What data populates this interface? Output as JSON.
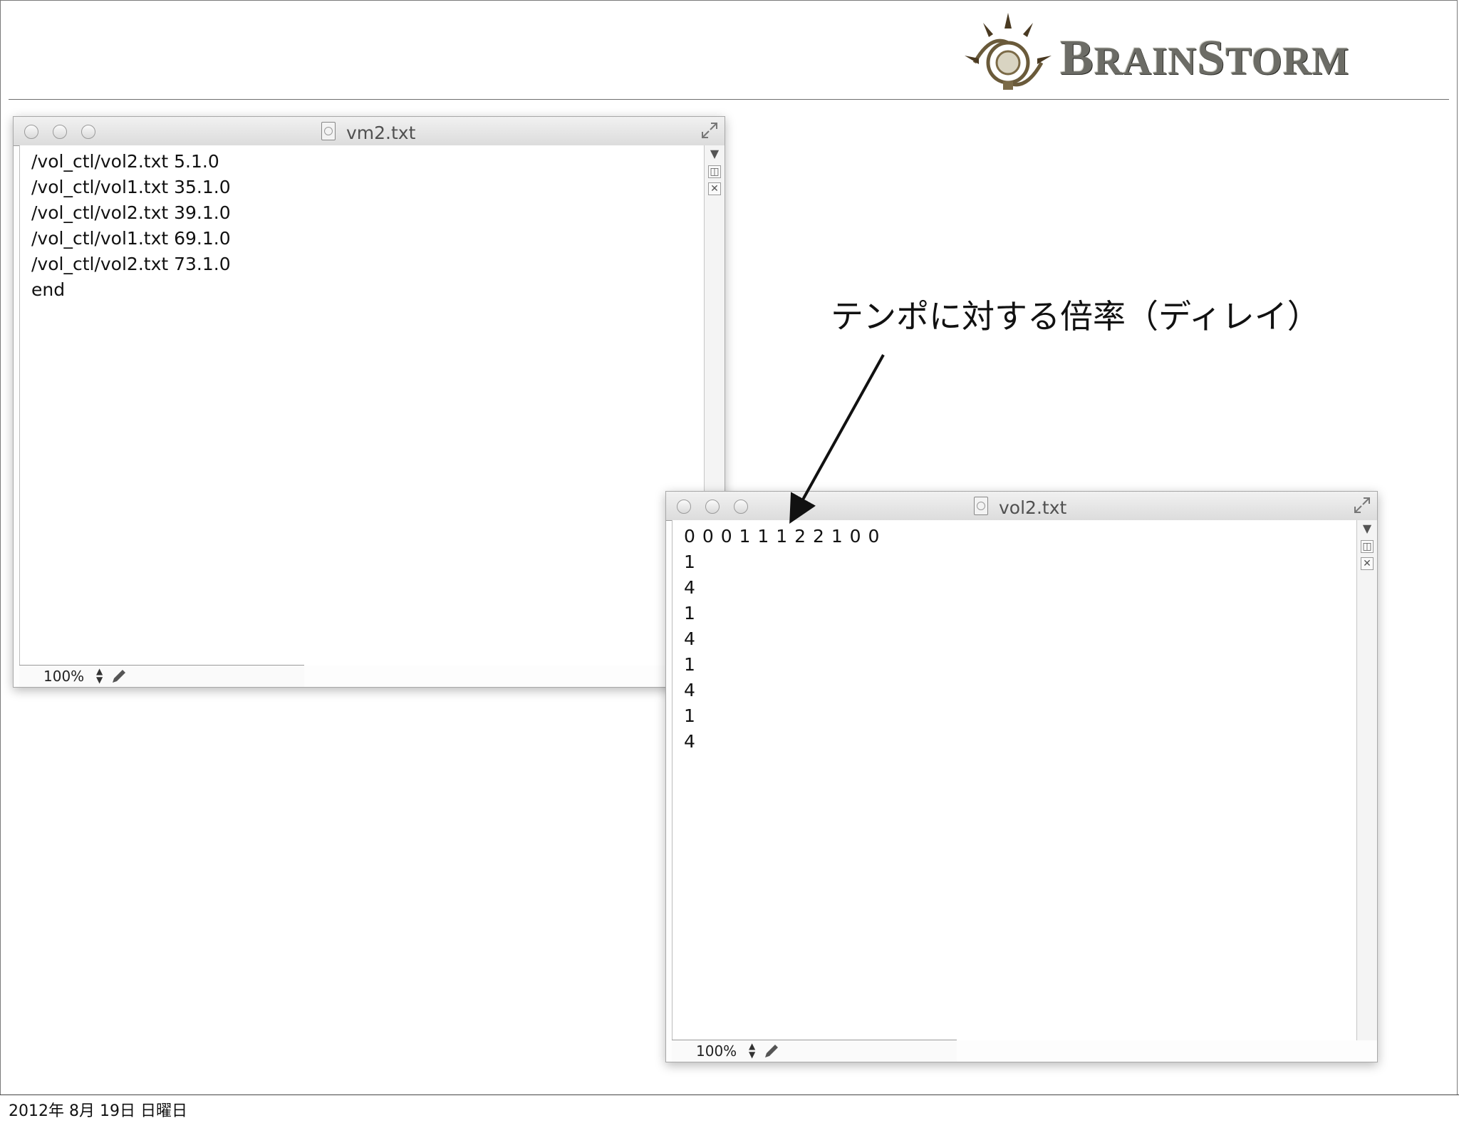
{
  "logo": {
    "brand_part1_initial": "B",
    "brand_part1_rest": "RAIN",
    "brand_part2_initial": "S",
    "brand_part2_rest": "TORM",
    "text": "BRAINSTORM"
  },
  "window_vm2": {
    "title": "vm2.txt",
    "lines": [
      "/vol_ctl/vol2.txt 5.1.0",
      "/vol_ctl/vol1.txt 35.1.0",
      "/vol_ctl/vol2.txt 39.1.0",
      "/vol_ctl/vol1.txt 69.1.0",
      "/vol_ctl/vol2.txt 73.1.0",
      "end"
    ],
    "zoom": "100%"
  },
  "window_vol2": {
    "title": "vol2.txt",
    "lines": [
      "0 0 0 1 1 1 2 2 1 0 0",
      "1",
      "4",
      "1",
      "4",
      "1",
      "4",
      "1",
      "4"
    ],
    "zoom": "100%"
  },
  "annotation": {
    "text": "テンポに対する倍率（ディレイ）"
  },
  "footer": {
    "date": "2012年 8月 19日 日曜日"
  },
  "colors": {
    "logo_text": "#6c6c66",
    "window_bg": "#fdfdfd",
    "titlebar": "#e4e4e4"
  }
}
